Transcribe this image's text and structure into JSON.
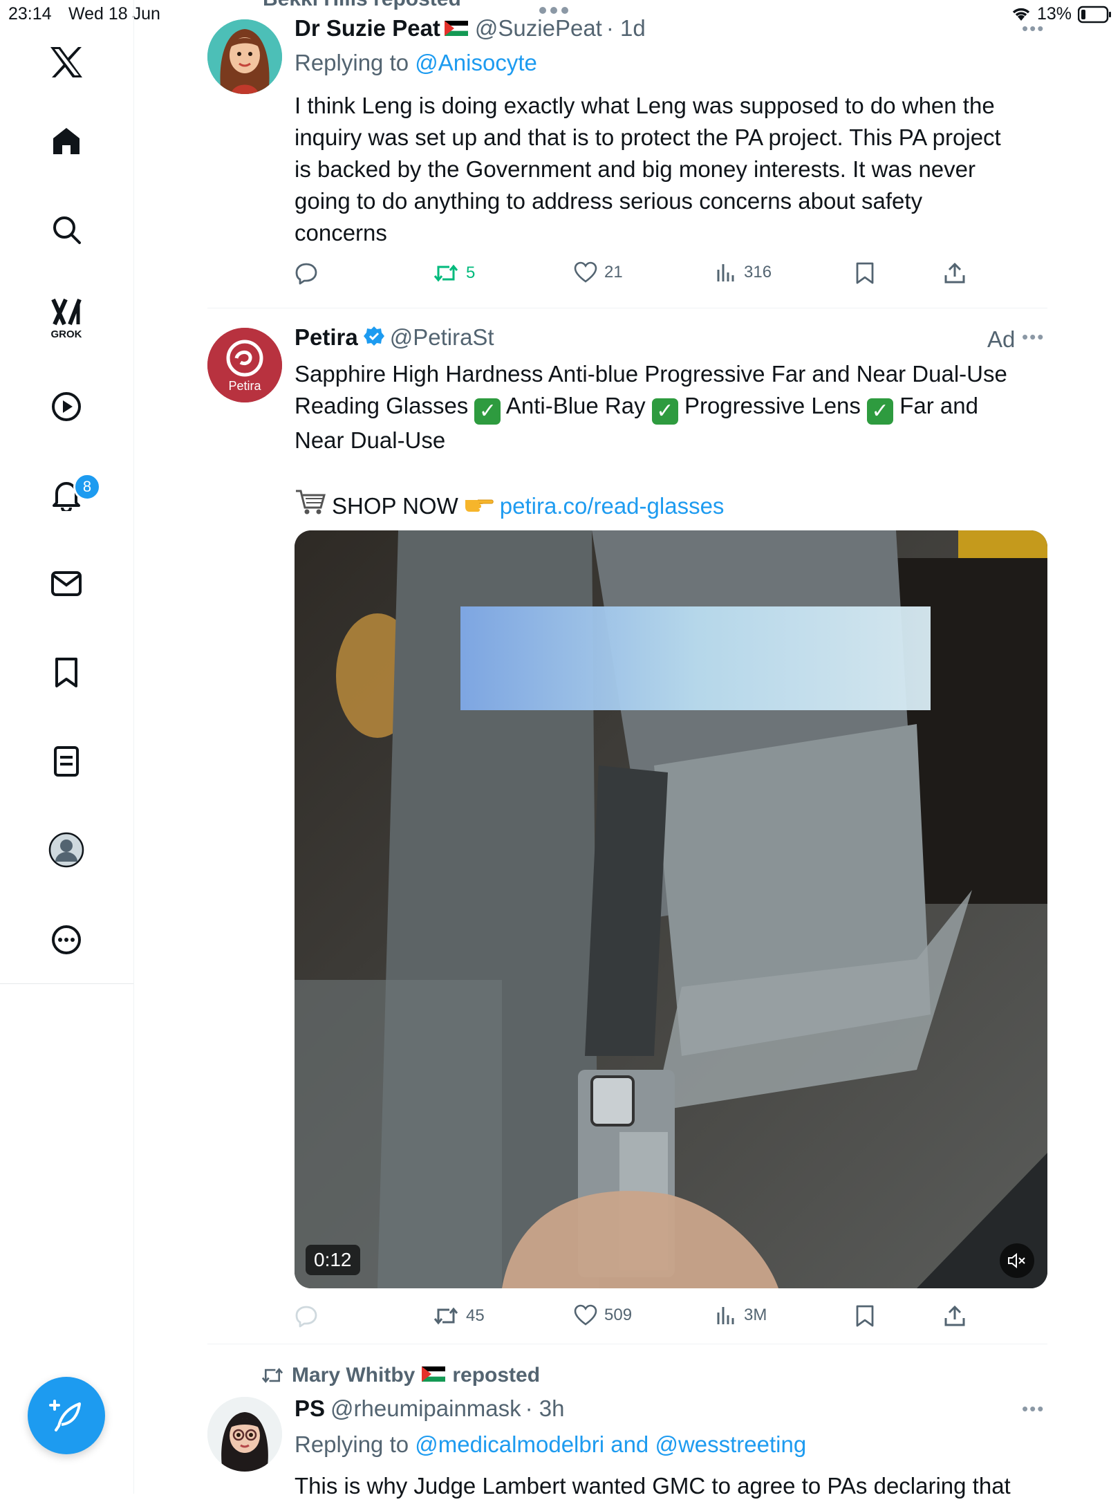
{
  "status_bar": {
    "time": "23:14",
    "date": "Wed 18 Jun",
    "battery": "13%"
  },
  "sidebar": {
    "items": [
      {
        "name": "home",
        "label": "Home"
      },
      {
        "name": "explore",
        "label": "Explore"
      },
      {
        "name": "grok",
        "label": "GROK"
      },
      {
        "name": "video",
        "label": "Video"
      },
      {
        "name": "notifications",
        "label": "Notifications"
      },
      {
        "name": "messages",
        "label": "Messages"
      },
      {
        "name": "bookmarks",
        "label": "Bookmarks"
      },
      {
        "name": "lists",
        "label": "Lists"
      },
      {
        "name": "profile",
        "label": "Profile"
      },
      {
        "name": "more",
        "label": "More"
      }
    ],
    "notification_count": "8"
  },
  "top_repost_partial": "Bekki Hills reposted",
  "tweet1": {
    "name": "Dr Suzie Peat",
    "handle": "@SuziePeat",
    "time": "· 1d",
    "replying_prefix": "Replying to",
    "replying_to": "@Anisocyte",
    "lines": [
      "I think Leng is doing exactly what Leng was supposed to do when the",
      "inquiry was set up and that is to protect the PA project. This PA project",
      "is backed by the Government and big money interests. It was never",
      "going to do anything to address serious concerns about safety",
      "concerns"
    ],
    "reposts": "5",
    "likes": "21",
    "views": "316"
  },
  "tweet2": {
    "name": "Petira",
    "handle": "@PetiraSt",
    "ad_label": "Ad",
    "avatar_text": "Petira",
    "line1": "Sapphire High Hardness Anti-blue Progressive Far and Near Dual-Use",
    "line2_a": "Reading Glasses",
    "line2_b": "Anti-Blue Ray",
    "line2_c": "Progressive Lens",
    "line2_d": "Far and",
    "line3": "Near Dual-Use",
    "shop_text": "SHOP NOW",
    "shop_link": "petira.co/read-glasses",
    "video_time": "0:12",
    "reposts": "45",
    "likes": "509",
    "views": "3M"
  },
  "tweet3": {
    "repost_by": "Mary Whitby",
    "repost_suffix": "reposted",
    "name": "PS",
    "handle": "@rheumipainmask",
    "time": "· 3h",
    "replying_prefix": "Replying to",
    "replying_to": "@medicalmodelbri and @wesstreeting",
    "partial_text": "This is why Judge Lambert wanted GMC to agree to PAs declaring that"
  },
  "colors": {
    "accent": "#1d9bf0",
    "repost_green": "#00ba7c",
    "secondary_text": "#536471"
  }
}
